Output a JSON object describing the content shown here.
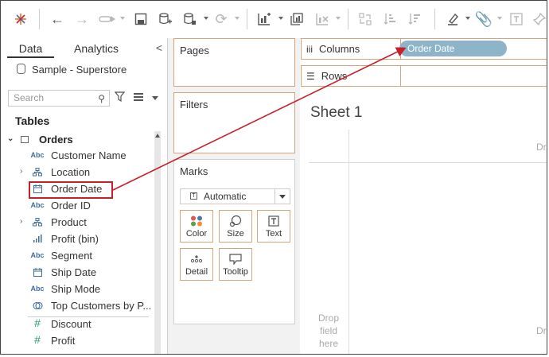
{
  "toolbar": {
    "icons": [
      "tableau-logo-icon",
      "undo-icon",
      "redo-icon",
      "replay-icon",
      "save-icon",
      "new-datasource-icon",
      "datasource-icon",
      "refresh-icon",
      "new-worksheet-icon",
      "duplicate-sheet-icon",
      "clear-sheet-icon",
      "swap-icon",
      "sort-ascending-icon",
      "sort-descending-icon",
      "highlight-icon",
      "annotate-icon",
      "text-label-icon",
      "pin-icon"
    ]
  },
  "left_pane": {
    "tabs": {
      "data": "Data",
      "analytics": "Analytics"
    },
    "collapse_glyph": "<",
    "datasource": "Sample - Superstore",
    "search_placeholder": "Search",
    "tables_heading": "Tables",
    "table_name": "Orders",
    "fields": [
      {
        "icon": "Abc",
        "label": "Customer Name",
        "expandable": false
      },
      {
        "icon": "hierarchy",
        "label": "Location",
        "expandable": true
      },
      {
        "icon": "calendar",
        "label": "Order Date",
        "expandable": false
      },
      {
        "icon": "Abc",
        "label": "Order ID",
        "expandable": false
      },
      {
        "icon": "hierarchy",
        "label": "Product",
        "expandable": true
      },
      {
        "icon": "bin",
        "label": "Profit (bin)",
        "expandable": false
      },
      {
        "icon": "Abc",
        "label": "Segment",
        "expandable": false
      },
      {
        "icon": "calendar",
        "label": "Ship Date",
        "expandable": false
      },
      {
        "icon": "Abc",
        "label": "Ship Mode",
        "expandable": false
      },
      {
        "icon": "set",
        "label": "Top Customers by P...",
        "expandable": false
      },
      {
        "icon": "#",
        "label": "Discount",
        "expandable": false
      },
      {
        "icon": "#",
        "label": "Profit",
        "expandable": false
      }
    ]
  },
  "mid_pane": {
    "pages": "Pages",
    "filters": "Filters",
    "marks": "Marks",
    "mark_type": "Automatic",
    "mark_buttons": {
      "color": "Color",
      "size": "Size",
      "text": "Text",
      "detail": "Detail",
      "tooltip": "Tooltip"
    },
    "text_icon_letter": "T"
  },
  "shelves": {
    "columns": "Columns",
    "rows": "Rows",
    "columns_pill": "Order Date"
  },
  "canvas": {
    "sheet_title": "Sheet 1",
    "drop_top_right": "Dr",
    "drop_bottom_left": [
      "Drop",
      "field",
      "here"
    ],
    "drop_bottom_right": "Dr"
  },
  "colors": {
    "annotation_red": "#c8202a",
    "pill_blue": "#8eb4c9",
    "shelf_border": "#d9a37a"
  }
}
